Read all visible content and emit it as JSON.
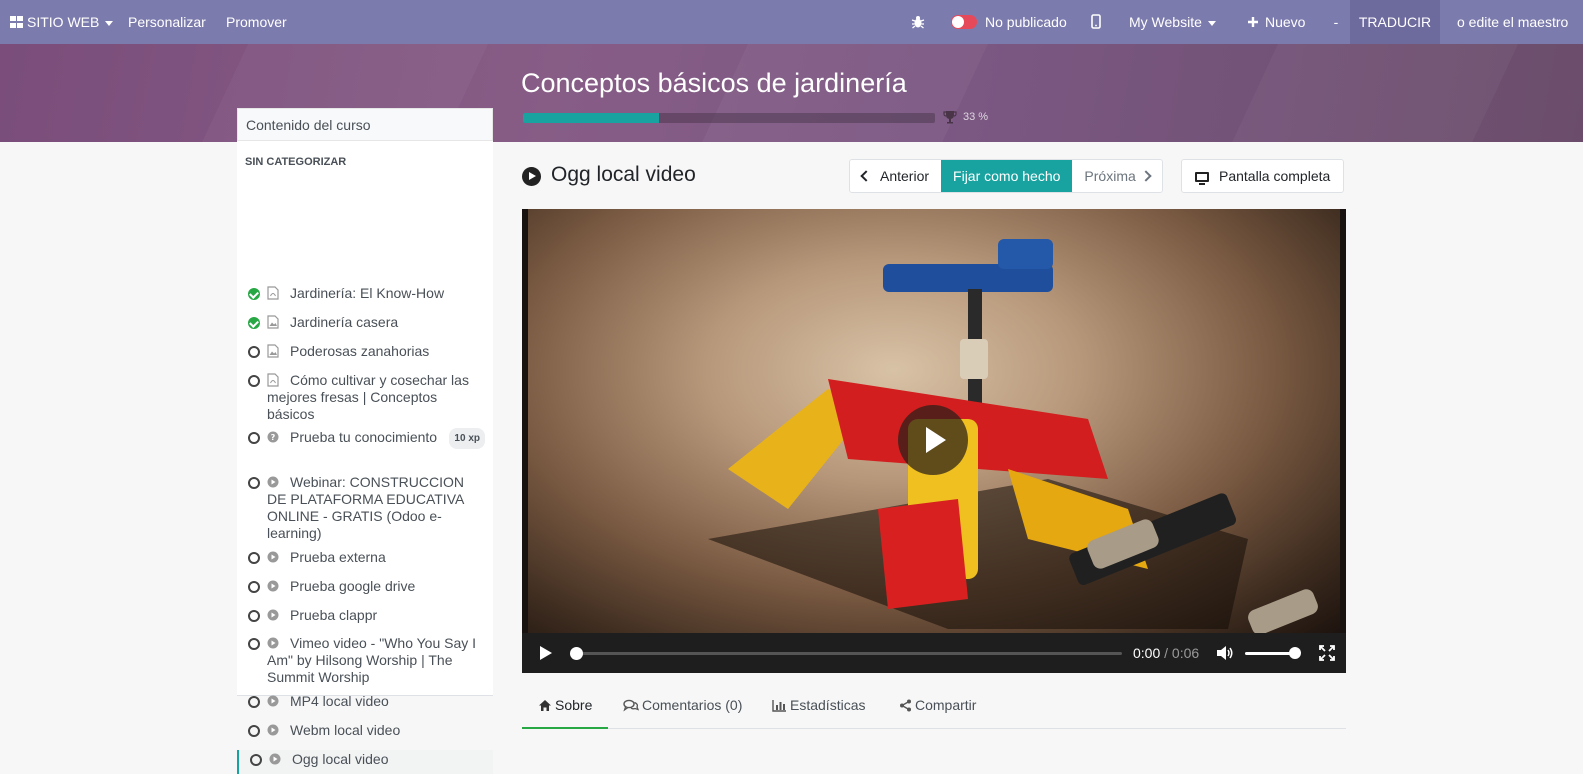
{
  "topbar": {
    "site_menu": "SITIO WEB",
    "customize": "Personalizar",
    "promote": "Promover",
    "publish_status": "No publicado",
    "website_selector": "My Website",
    "new_button": "Nuevo",
    "more_button": "-",
    "translate_button": "TRADUCIR",
    "edit_master": "o edite el maestro"
  },
  "course": {
    "title": "Conceptos básicos de jardinería",
    "progress_percent": 33,
    "progress_label": "33 %"
  },
  "sidebar": {
    "heading": "Contenido del curso",
    "category": "SIN CATEGORIZAR",
    "lessons": [
      {
        "title": "Jardinería: El Know-How",
        "type": "pdf",
        "done": true
      },
      {
        "title": "Jardinería casera",
        "type": "image",
        "done": true
      },
      {
        "title": "Poderosas zanahorias",
        "type": "image",
        "done": false
      },
      {
        "title": "Cómo cultivar y cosechar las mejores fresas | Conceptos básicos",
        "type": "pdf",
        "done": false
      },
      {
        "title": "Prueba tu conocimiento",
        "type": "quiz",
        "done": false,
        "badge": "10 xp"
      },
      {
        "title": "Webinar: CONSTRUCCION DE PLATAFORMA EDUCATIVA ONLINE - GRATIS (Odoo e-learning)",
        "type": "video",
        "done": false
      },
      {
        "title": "Prueba externa",
        "type": "video",
        "done": false
      },
      {
        "title": "Prueba google drive",
        "type": "video",
        "done": false
      },
      {
        "title": "Prueba clappr",
        "type": "video",
        "done": false
      },
      {
        "title": "Vimeo video - \"Who You Say I Am\" by Hilsong Worship | The Summit Worship",
        "type": "video",
        "done": false
      },
      {
        "title": "MP4 local video",
        "type": "video",
        "done": false
      },
      {
        "title": "Webm local video",
        "type": "video",
        "done": false
      },
      {
        "title": "Ogg local video",
        "type": "video",
        "done": false,
        "active": true
      }
    ]
  },
  "slide": {
    "title": "Ogg local video",
    "prev_label": "Anterior",
    "mark_done_label": "Fijar como hecho",
    "next_label": "Próxima",
    "fullscreen_label": "Pantalla completa"
  },
  "player": {
    "current_time": "0:00",
    "separator": " / ",
    "duration": "0:06",
    "volume_level": 0.9
  },
  "tabs": [
    {
      "label": "Sobre",
      "icon": "home-icon",
      "active": true
    },
    {
      "label": "Comentarios (0)",
      "icon": "comments-icon"
    },
    {
      "label": "Estadísticas",
      "icon": "bar-chart-icon"
    },
    {
      "label": "Compartir",
      "icon": "share-icon"
    }
  ],
  "colors": {
    "navbar": "#7c7bad",
    "accent": "#18a3a0",
    "done": "#28a745"
  }
}
